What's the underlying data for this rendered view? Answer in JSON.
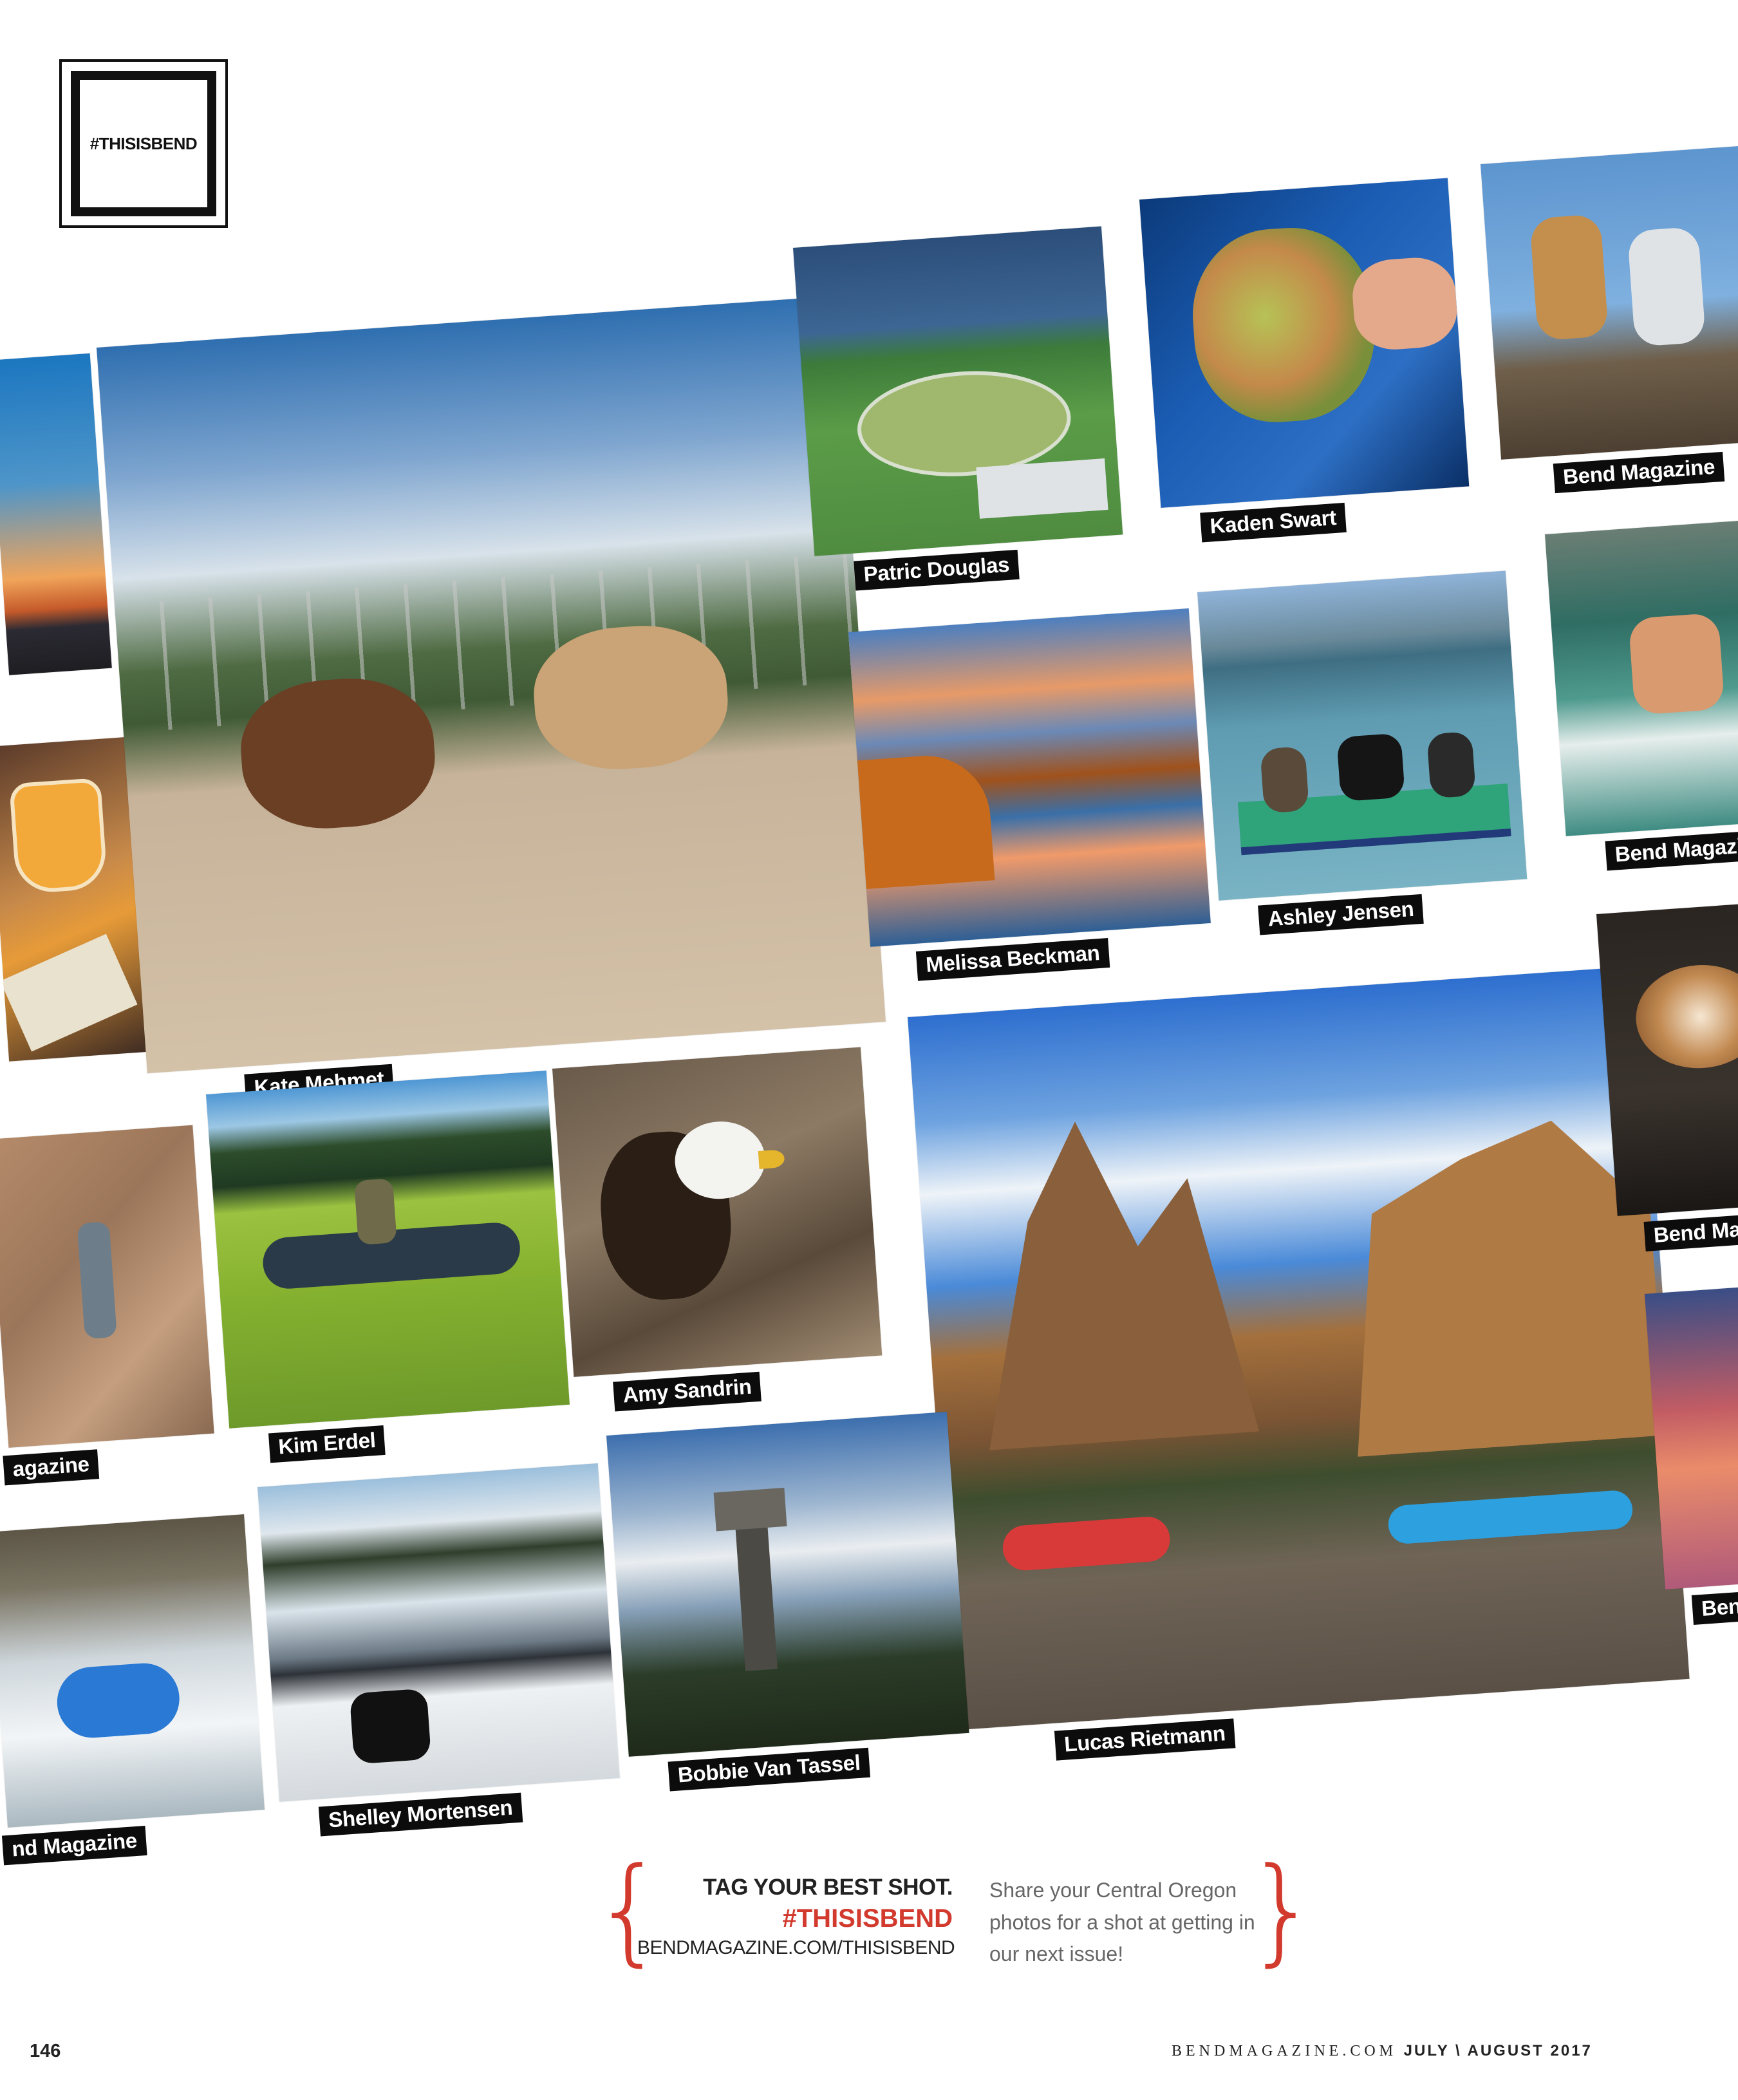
{
  "logo": {
    "label": "#THISISBEND"
  },
  "photos": [
    {
      "id": "p-edge-sunset",
      "credit": ""
    },
    {
      "id": "p-edge-beer",
      "credit": ""
    },
    {
      "id": "p-edge-climb",
      "credit": "agazine"
    },
    {
      "id": "p-edge-raft",
      "credit": "nd Magazine"
    },
    {
      "id": "p-horses",
      "credit": "Kate Mehmet"
    },
    {
      "id": "p-park",
      "credit": "Patric Douglas"
    },
    {
      "id": "p-trout",
      "credit": "Kaden Swart"
    },
    {
      "id": "p-dogs-rock",
      "credit": "Bend Magazine"
    },
    {
      "id": "p-reflection",
      "credit": "Melissa Beckman"
    },
    {
      "id": "p-dogs-board",
      "credit": "Ashley Jensen"
    },
    {
      "id": "p-jump",
      "credit": "Bend Magazine"
    },
    {
      "id": "p-kayak-lake",
      "credit": "Kim Erdel"
    },
    {
      "id": "p-eagle",
      "credit": "Amy Sandrin"
    },
    {
      "id": "p-smith-rock",
      "credit": "Lucas Rietmann"
    },
    {
      "id": "p-coffee",
      "credit": "Bend Ma"
    },
    {
      "id": "p-lake-dog",
      "credit": "Shelley Mortensen"
    },
    {
      "id": "p-lookout",
      "credit": "Bobbie Van Tassel"
    },
    {
      "id": "p-edge-sky",
      "credit": "Bend"
    }
  ],
  "cta": {
    "headline": "TAG YOUR BEST SHOT.",
    "hashtag": "#THISISBEND",
    "url": "BENDMAGAZINE.COM/THISISBEND",
    "body": "Share your Central Oregon photos for a shot at getting in our next issue!"
  },
  "footer": {
    "page_number": "146",
    "site": "BENDMAGAZINE.COM",
    "issue": "JULY \\ AUGUST 2017"
  },
  "colors": {
    "accent": "#d23a2e",
    "caption_bg": "#0c0c0c"
  }
}
